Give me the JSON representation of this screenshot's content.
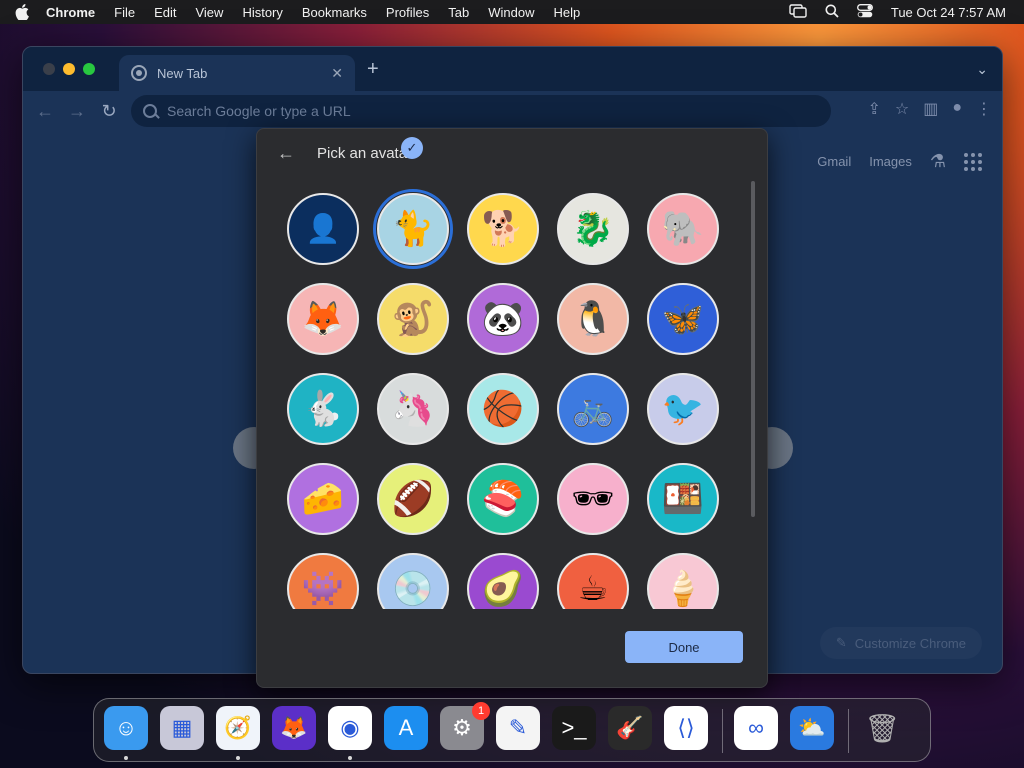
{
  "menubar": {
    "app_name": "Chrome",
    "items": [
      "File",
      "Edit",
      "View",
      "History",
      "Bookmarks",
      "Profiles",
      "Tab",
      "Window",
      "Help"
    ],
    "clock": "Tue Oct 24  7:57 AM"
  },
  "browser": {
    "tab_title": "New Tab",
    "omnibox_placeholder": "Search Google or type a URL",
    "ntp_links": {
      "gmail": "Gmail",
      "images": "Images"
    },
    "customize_label": "Customize Chrome"
  },
  "dialog": {
    "title": "Pick an avatar",
    "done_label": "Done",
    "selected_avatar": "siamese-cat",
    "avatars": [
      {
        "name": "generic-person",
        "glyph": "👤",
        "bg": "#0b2e5e"
      },
      {
        "name": "siamese-cat",
        "glyph": "🐈",
        "bg": "#a8d4e4"
      },
      {
        "name": "corgi",
        "glyph": "🐕",
        "bg": "#ffd84d"
      },
      {
        "name": "dragon",
        "glyph": "🐉",
        "bg": "#e6e6e0"
      },
      {
        "name": "elephant",
        "glyph": "🐘",
        "bg": "#f7a8b0"
      },
      {
        "name": "fox",
        "glyph": "🦊",
        "bg": "#f6b5b5"
      },
      {
        "name": "monkey",
        "glyph": "🐒",
        "bg": "#f5dc6a"
      },
      {
        "name": "panda",
        "glyph": "🐼",
        "bg": "#b06ad8"
      },
      {
        "name": "penguin",
        "glyph": "🐧",
        "bg": "#f2b8a6"
      },
      {
        "name": "butterfly",
        "glyph": "🦋",
        "bg": "#2f5fd8"
      },
      {
        "name": "rabbit",
        "glyph": "🐇",
        "bg": "#1fb3c4"
      },
      {
        "name": "unicorn",
        "glyph": "🦄",
        "bg": "#d8dcdc"
      },
      {
        "name": "basketball",
        "glyph": "🏀",
        "bg": "#a8e8e8"
      },
      {
        "name": "bicycle",
        "glyph": "🚲",
        "bg": "#3d7ae0"
      },
      {
        "name": "bird",
        "glyph": "🐦",
        "bg": "#c8ccea"
      },
      {
        "name": "cheese",
        "glyph": "🧀",
        "bg": "#b070e0"
      },
      {
        "name": "football",
        "glyph": "🏈",
        "bg": "#e6f07a"
      },
      {
        "name": "sushi-plate",
        "glyph": "🍣",
        "bg": "#1fbf9a"
      },
      {
        "name": "sunglasses",
        "glyph": "🕶",
        "bg": "#f7b0cc"
      },
      {
        "name": "sushi-roll",
        "glyph": "🍱",
        "bg": "#19b8c8"
      },
      {
        "name": "game-device",
        "glyph": "👾",
        "bg": "#f07a40"
      },
      {
        "name": "vinyl-record",
        "glyph": "💿",
        "bg": "#a8c8f0"
      },
      {
        "name": "avocado",
        "glyph": "🥑",
        "bg": "#9a4ad0"
      },
      {
        "name": "cappuccino",
        "glyph": "☕",
        "bg": "#f06040"
      },
      {
        "name": "ice-cream",
        "glyph": "🍦",
        "bg": "#f8c8d4"
      }
    ]
  },
  "dock": {
    "apps": [
      {
        "name": "finder",
        "glyph": "☺",
        "bg": "#3a9aef",
        "running": true
      },
      {
        "name": "launchpad",
        "glyph": "▦",
        "bg": "#c8c8d8",
        "running": false
      },
      {
        "name": "safari",
        "glyph": "🧭",
        "bg": "#f0f4fa",
        "running": true
      },
      {
        "name": "firefox",
        "glyph": "🦊",
        "bg": "#5b2fc8",
        "running": false
      },
      {
        "name": "chrome",
        "glyph": "◉",
        "bg": "#ffffff",
        "running": true
      },
      {
        "name": "app-store",
        "glyph": "A",
        "bg": "#1c8ef0",
        "running": false
      },
      {
        "name": "system-settings",
        "glyph": "⚙",
        "bg": "#8a8a90",
        "running": false,
        "badge": "1"
      },
      {
        "name": "textedit",
        "glyph": "✎",
        "bg": "#f4f4f4",
        "running": false
      },
      {
        "name": "terminal",
        "glyph": ">_",
        "bg": "#1a1a1a",
        "running": false
      },
      {
        "name": "garageband",
        "glyph": "🎸",
        "bg": "#2a2a2a",
        "running": false
      },
      {
        "name": "vscode",
        "glyph": "⟨⟩",
        "bg": "#ffffff",
        "running": false
      },
      {
        "name": "visual-studio",
        "glyph": "∞",
        "bg": "#ffffff",
        "running": false
      },
      {
        "name": "weather",
        "glyph": "⛅",
        "bg": "#2a7ae0",
        "running": false
      },
      {
        "name": "trash",
        "glyph": "🗑",
        "bg": "transparent",
        "running": false
      }
    ]
  }
}
